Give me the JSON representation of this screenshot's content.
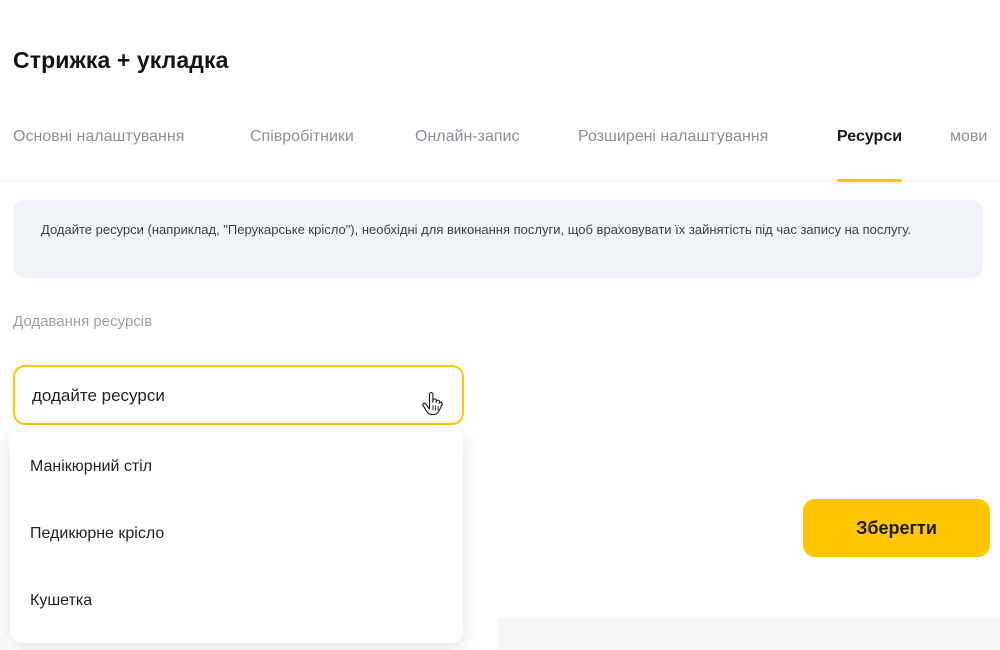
{
  "page": {
    "title": "Стрижка + укладка"
  },
  "tabs": [
    {
      "label": "Основні налаштування",
      "active": false
    },
    {
      "label": "Співробітники",
      "active": false
    },
    {
      "label": "Онлайн-запис",
      "active": false
    },
    {
      "label": "Розширені налаштування",
      "active": false
    },
    {
      "label": "Ресурси",
      "active": true
    },
    {
      "label": "мови",
      "active": false
    }
  ],
  "info": {
    "text": "Додайте ресурси (наприклад, \"Перукарське крісло\"), необхідні для виконання послуги, щоб враховувати їх зайнятість під час запису на послугу."
  },
  "resources": {
    "label": "Додавання ресурсів",
    "select_placeholder": "додайте ресурси",
    "options": [
      "Манікюрний стіл",
      "Педикюрне крісло",
      "Кушетка"
    ]
  },
  "actions": {
    "save_label": "Зберегти"
  },
  "colors": {
    "accent": "#ffc600",
    "info_bg": "#f0f3f7",
    "muted_text": "#8a8f99"
  },
  "icons": {
    "cursor": "hand-pointer-icon"
  }
}
